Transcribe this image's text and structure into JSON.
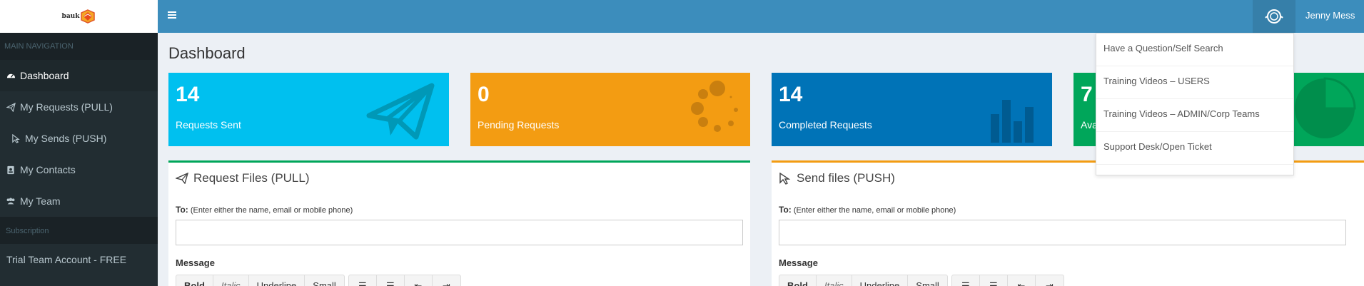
{
  "logo": {
    "text": "bauk"
  },
  "sidebar": {
    "header": "MAIN NAVIGATION",
    "items": [
      {
        "label": "Dashboard",
        "icon": "dashboard-icon"
      },
      {
        "label": "My Requests (PULL)",
        "icon": "paper-plane-icon"
      },
      {
        "label": "My Sends (PUSH)",
        "icon": "cursor-icon"
      },
      {
        "label": "My Contacts",
        "icon": "contacts-icon"
      },
      {
        "label": "My Team",
        "icon": "users-icon"
      }
    ],
    "subscription_header": "Subscription",
    "trial_label": "Trial Team Account - FREE"
  },
  "topbar": {
    "user_name": "Jenny Mess",
    "help_icon": "lifebuoy-icon",
    "menu_icon": "hamburger-icon"
  },
  "page": {
    "title": "Dashboard"
  },
  "stats": [
    {
      "value": "14",
      "label": "Requests Sent",
      "color": "#00c0ef",
      "icon": "paper-plane-icon"
    },
    {
      "value": "0",
      "label": "Pending Requests",
      "color": "#f39c12",
      "icon": "spinner-icon"
    },
    {
      "value": "14",
      "label": "Completed Requests",
      "color": "#0073b7",
      "icon": "bar-chart-icon"
    },
    {
      "value": "7",
      "label": "Ava",
      "color": "#00a65a",
      "icon": "pie-chart-icon"
    }
  ],
  "panels": {
    "request": {
      "title": "Request Files (PULL)",
      "to_label": "To:",
      "to_hint": "(Enter either the name, email or mobile phone)",
      "to_value": "",
      "message_label": "Message",
      "accent": "#00a65a"
    },
    "send": {
      "title": "Send files (PUSH)",
      "to_label": "To:",
      "to_hint": "(Enter either the name, email or mobile phone)",
      "to_value": "",
      "message_label": "Message",
      "accent": "#f39c12"
    }
  },
  "editor_toolbar": {
    "bold": "Bold",
    "italic": "Italic",
    "underline": "Underline",
    "small": "Small"
  },
  "help_menu": {
    "items": [
      "Have a Question/Self Search",
      "Training Videos – USERS",
      "Training Videos – ADMIN/Corp Teams",
      "Support Desk/Open Ticket"
    ]
  }
}
